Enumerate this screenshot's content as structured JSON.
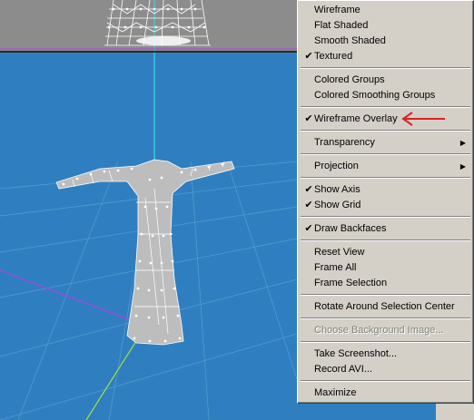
{
  "menu": {
    "wireframe": "Wireframe",
    "flat_shaded": "Flat Shaded",
    "smooth_shaded": "Smooth Shaded",
    "textured": "Textured",
    "colored_groups": "Colored Groups",
    "colored_smoothing_groups": "Colored Smoothing Groups",
    "wireframe_overlay": "Wireframe Overlay",
    "transparency": "Transparency",
    "projection": "Projection",
    "show_axis": "Show Axis",
    "show_grid": "Show Grid",
    "draw_backfaces": "Draw Backfaces",
    "reset_view": "Reset View",
    "frame_all": "Frame All",
    "frame_selection": "Frame Selection",
    "rotate_around_selection_center": "Rotate Around Selection Center",
    "choose_background_image": "Choose Background Image...",
    "take_screenshot": "Take Screenshot...",
    "record_avi": "Record AVI...",
    "maximize": "Maximize"
  },
  "checked_items": [
    "Textured",
    "Wireframe Overlay",
    "Show Axis",
    "Show Grid",
    "Draw Backfaces"
  ],
  "disabled_items": [
    "Choose Background Image..."
  ],
  "icons": {
    "check": "✔",
    "submenu": "▶"
  },
  "colors": {
    "viewport_bg": "#2f7fc0",
    "top_view_bg": "#8c8c8c",
    "menu_bg": "#d4d0c8",
    "annotation_arrow": "#e02020",
    "axis_cyan": "#33e0e0",
    "axis_magenta": "#b040e0",
    "axis_green": "#a0e040"
  }
}
